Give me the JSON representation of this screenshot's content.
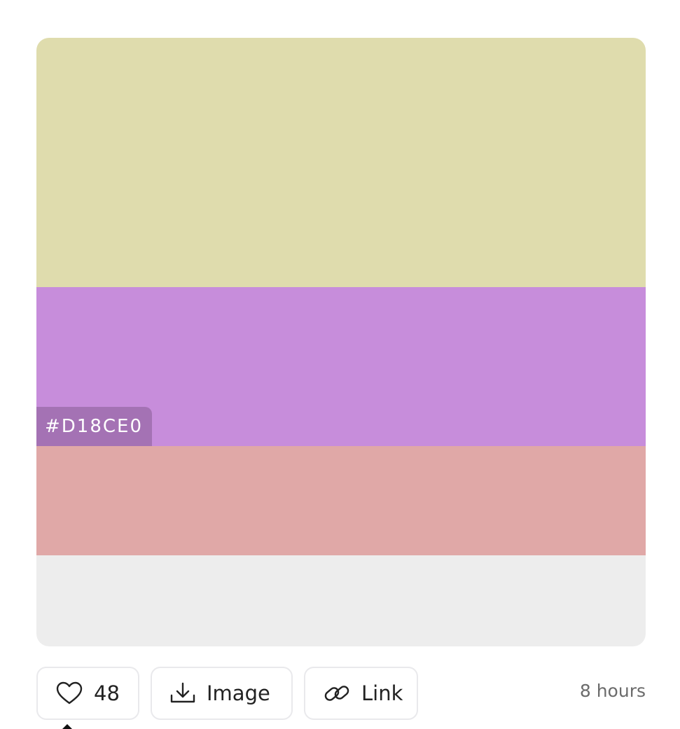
{
  "palette": {
    "swatches": [
      {
        "color": "#DFDCAD"
      },
      {
        "color": "#C78DDB",
        "hex_label": "#D18CE0"
      },
      {
        "color": "#E0A8A7"
      },
      {
        "color": "#EDEDED"
      }
    ]
  },
  "actions": {
    "likes_count": "48",
    "image_label": "Image",
    "link_label": "Link"
  },
  "meta": {
    "time_ago": "8 hours"
  },
  "icons": {
    "like": "heart-icon",
    "image": "download-icon",
    "link": "link-icon"
  }
}
